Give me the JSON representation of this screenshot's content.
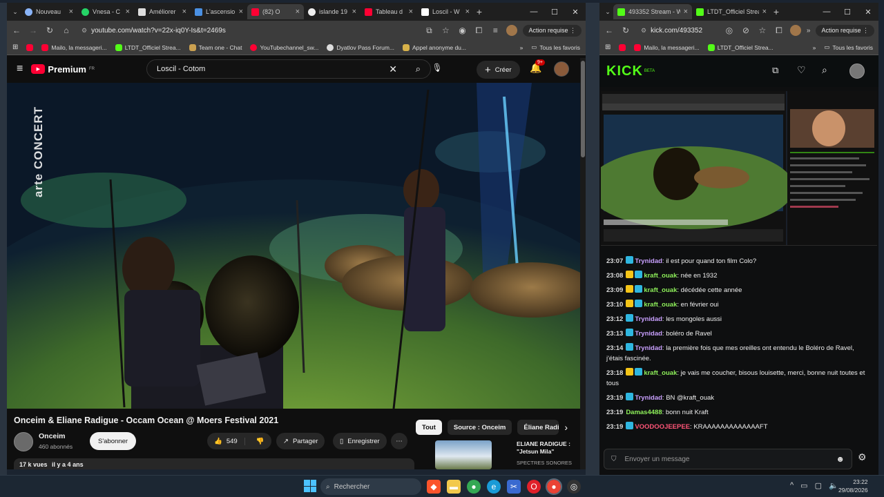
{
  "left_browser": {
    "tabs": [
      {
        "label": "Nouveau",
        "color": "#8ab4f8",
        "active": false
      },
      {
        "label": "Vnesa - C",
        "color": "#25d366",
        "active": false
      },
      {
        "label": "Améliorer",
        "color": "#dddddd",
        "active": false
      },
      {
        "label": "L'ascensio",
        "color": "#4a90e2",
        "active": false
      },
      {
        "label": "(82) O",
        "color": "#ff0033",
        "active": true
      },
      {
        "label": "islande 19",
        "color": "#eeeeee",
        "active": false
      },
      {
        "label": "Tableau d",
        "color": "#ff0033",
        "active": false
      },
      {
        "label": "Loscil - W",
        "color": "#ffffff",
        "active": false
      }
    ],
    "url": "youtube.com/watch?v=22x-iq0Y-Is&t=2469s",
    "action_label": "Action requise",
    "bookmarks": [
      "Mailo, la messageri...",
      "LTDT_Officiel Strea...",
      "Team one - Chat",
      "YouTubechannel_sw...",
      "Dyatlov Pass Forum...",
      "Appel anonyme du..."
    ],
    "bookmarks_all": "Tous les favoris"
  },
  "youtube": {
    "logo_text": "Premium",
    "logo_region": "FR",
    "search_value": "Loscil - Cotom",
    "create_label": "Créer",
    "notif_count": "9+",
    "video_overlay_brand": "arte CONCERT",
    "video_title": "Onceim & Eliane Radigue - Occam Ocean @ Moers Festival 2021",
    "channel_name": "Onceim",
    "channel_subs": "460 abonnés",
    "subscribe_label": "S'abonner",
    "likes": "549",
    "share_label": "Partager",
    "save_label": "Enregistrer",
    "views": "17 k vues",
    "age": "il y a 4 ans",
    "chips": [
      "Tout",
      "Source : Onceim",
      "Éliane Radig"
    ],
    "rec_title": "ELIANE RADIGUE : \"Jetsun Mila\"",
    "rec_channel": "SPECTRES SONORES"
  },
  "right_browser": {
    "tabs": [
      {
        "label": "493352 Stream - W",
        "color": "#53fc18",
        "active": true
      },
      {
        "label": "LTDT_Officiel Strea",
        "color": "#53fc18",
        "active": false
      }
    ],
    "url": "kick.com/493352",
    "action_label": "Action requise",
    "bookmarks": [
      "Mailo, la messageri...",
      "LTDT_Officiel Strea..."
    ],
    "bookmarks_all": "Tous les favoris"
  },
  "kick": {
    "logo": "KICK",
    "logo_badge": "BETA",
    "chat_placeholder": "Envoyer un message",
    "messages": [
      {
        "time": "23:07",
        "user": "Trynidad",
        "color": "#c9a0ff",
        "text": "il est pour quand ton film Colo?"
      },
      {
        "time": "23:08",
        "user": "kraft_ouak",
        "color": "#8ef05a",
        "text": "née en 1932"
      },
      {
        "time": "23:09",
        "user": "kraft_ouak",
        "color": "#8ef05a",
        "text": "décédée cette année"
      },
      {
        "time": "23:10",
        "user": "kraft_ouak",
        "color": "#8ef05a",
        "text": "en février oui"
      },
      {
        "time": "23:12",
        "user": "Trynidad",
        "color": "#c9a0ff",
        "text": "les mongoles aussi"
      },
      {
        "time": "23:13",
        "user": "Trynidad",
        "color": "#c9a0ff",
        "text": "boléro de Ravel"
      },
      {
        "time": "23:14",
        "user": "Trynidad",
        "color": "#c9a0ff",
        "text": "la première fois que mes oreilles ont entendu le Boléro de Ravel, j'étais fascinée."
      },
      {
        "time": "23:18",
        "user": "kraft_ouak",
        "color": "#8ef05a",
        "text": "je vais me coucher, bisous louisette, merci, bonne nuit toutes et tous"
      },
      {
        "time": "23:19",
        "user": "Trynidad",
        "color": "#c9a0ff",
        "text": "BN @kraft_ouak"
      },
      {
        "time": "23:19",
        "user": "Damas4488",
        "color": "#8ef05a",
        "text": "bonn nuit Kraft"
      },
      {
        "time": "23:19",
        "user": "VOODOOJEEPEE",
        "color": "#ff5577",
        "text": "KRAAAAAAAAAAAAAFT"
      }
    ]
  },
  "taskbar": {
    "search_label": "Rechercher",
    "time": "23:22",
    "date": "29/08/2026"
  }
}
